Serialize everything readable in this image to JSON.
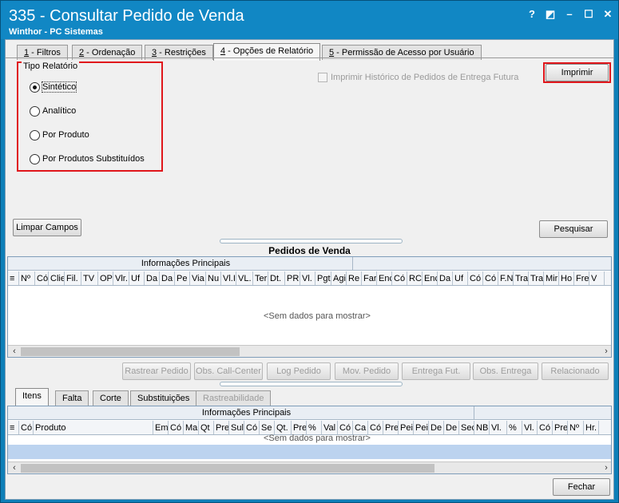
{
  "window": {
    "title": "335 - Consultar Pedido de Venda",
    "subtitle": "Winthor - PC Sistemas",
    "controls": [
      "?",
      "◩",
      "–",
      "☐",
      "✕"
    ]
  },
  "tabs": [
    {
      "key": "1",
      "label": " - Filtros"
    },
    {
      "key": "2",
      "label": " - Ordenação"
    },
    {
      "key": "3",
      "label": " - Restrições"
    },
    {
      "key": "4",
      "label": " - Opções de Relatório"
    },
    {
      "key": "5",
      "label": " - Permissão de Acesso por Usuário"
    }
  ],
  "report_type": {
    "legend": "Tipo Relatório",
    "options": [
      "Sintético",
      "Analítico",
      "Por Produto",
      "Por Produtos Substituídos"
    ],
    "selected": "Sintético"
  },
  "checkbox_history": "Imprimir Histórico de Pedidos de Entrega Futura",
  "buttons": {
    "print": "Imprimir",
    "clear": "Limpar Campos",
    "search": "Pesquisar",
    "close": "Fechar"
  },
  "orders_grid": {
    "title": "Pedidos de  Venda",
    "band": "Informações Principais",
    "columns": [
      "Nº",
      "Có",
      "Clie",
      "Fil.",
      "TV",
      "OP",
      "Vlr.",
      "Uf",
      "Da",
      "Da",
      "Pe",
      "Via",
      "Nu",
      "Vl.I",
      "VL.",
      "Ter",
      "Dt.",
      "PR.",
      "Vl.",
      "Pgt",
      "Agi",
      "Re",
      "Far",
      "Enc",
      "Có",
      "RC",
      "Enc",
      "Da",
      "Uf",
      "Có",
      "Có",
      "F.N",
      "Tra",
      "Tra",
      "Mir",
      "Ho",
      "Fre",
      "V"
    ],
    "empty": "<Sem dados para mostrar>"
  },
  "action_buttons": [
    "Rastrear Pedido",
    "Obs. Call-Center",
    "Log Pedido",
    "Mov. Pedido",
    "Entrega Fut.",
    "Obs. Entrega",
    "Relacionado"
  ],
  "bottom_tabs": [
    "Itens",
    "Falta",
    "Corte",
    "Substituições",
    "Rastreabilidade"
  ],
  "items_grid": {
    "band": "Informações Principais",
    "columns": [
      "Có",
      "Produto",
      "Em",
      "Có",
      "Ma",
      "Qt",
      "Pre",
      "Sul",
      "Có",
      "Se",
      "Qt.",
      "Pre",
      "%",
      "Val",
      "Có",
      "Ca",
      "Có",
      "Pre",
      "Pei",
      "Pei",
      "De",
      "De",
      "Sec",
      "NBI",
      "Vl.",
      "%",
      "Vl.",
      "Có",
      "Pre",
      "Nº",
      "Hr."
    ],
    "empty": "<Sem dados para mostrar>"
  },
  "colors": {
    "title_bar": "#1187c4",
    "highlight": "#e0161b",
    "grid_band": "#e9eef4"
  }
}
